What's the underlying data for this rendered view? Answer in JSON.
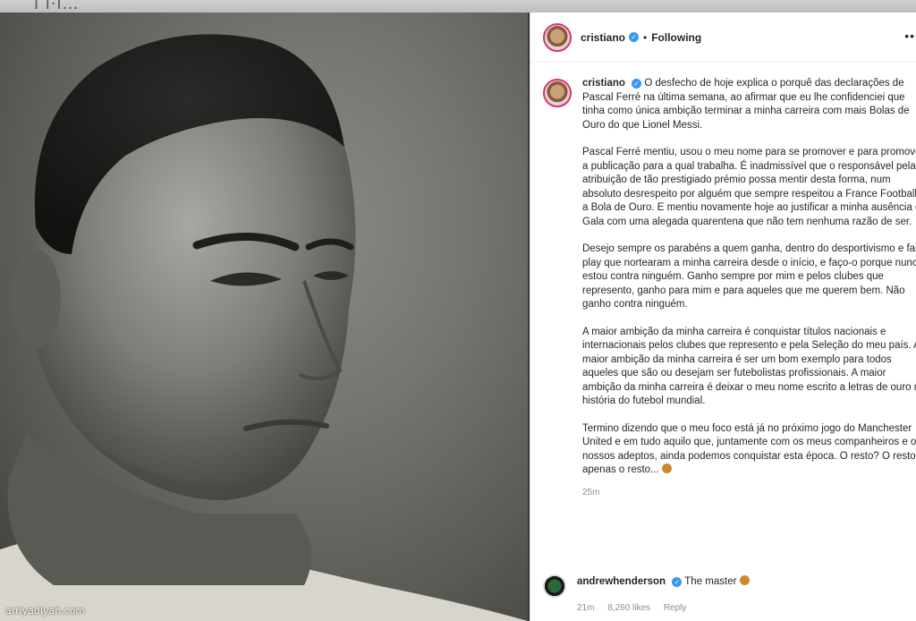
{
  "header": {
    "ghost_text": "i i·i…",
    "username": "cristiano",
    "separator": "•",
    "follow_status": "Following",
    "more_icon": "more-dots-icon"
  },
  "photo": {
    "alt_subject": "portrait-photo"
  },
  "watermark": "arriyadiyah.com",
  "caption": {
    "username": "cristiano",
    "paragraphs": [
      "O desfecho de hoje explica o porquê das declarações de Pascal Ferré na última semana, ao afirmar que eu lhe confidenciei que tinha como única ambição terminar a minha carreira com mais Bolas de Ouro do que Lionel Messi.",
      "Pascal Ferré mentiu, usou o meu nome para se promover e para promover a publicação para a qual trabalha. É inadmissível que o responsável pela atribuição de tão prestigiado prémio possa mentir desta forma, num absoluto desrespeito por alguém que sempre respeitou a France Football e a Bola de Ouro. E mentiu novamente hoje ao justificar a minha ausência da Gala com uma alegada quarentena que não tem nenhuma razão de ser.",
      "Desejo sempre os parabéns a quem ganha, dentro do desportivismo e fair-play que nortearam a minha carreira desde o início, e faço-o porque nunca estou contra ninguém. Ganho sempre por mim e pelos clubes que represento, ganho para mim e para aqueles que me querem bem. Não ganho contra ninguém.",
      "A maior ambição da minha carreira é conquistar títulos nacionais e internacionais pelos clubes que represento e pela Seleção do meu país. A maior ambição da minha carreira é ser um bom exemplo para todos aqueles que são ou desejam ser futebolistas profissionais. A maior ambição da minha carreira é deixar o meu nome escrito a letras de ouro na história do futebol mundial.",
      "Termino dizendo que o meu foco está já no próximo jogo do Manchester United e em tudo aquilo que, juntamente com os meus companheiros e os nossos adeptos, ainda podemos conquistar esta época. O resto? O resto é apenas o resto..."
    ],
    "time": "25m"
  },
  "comment": {
    "username": "andrewhenderson",
    "text": "The master",
    "time": "21m",
    "likes": "8,260 likes",
    "reply": "Reply"
  },
  "colors": {
    "verified": "#3897f0",
    "story_ring": "#e1306c",
    "meta_text": "#8e8e8e"
  }
}
